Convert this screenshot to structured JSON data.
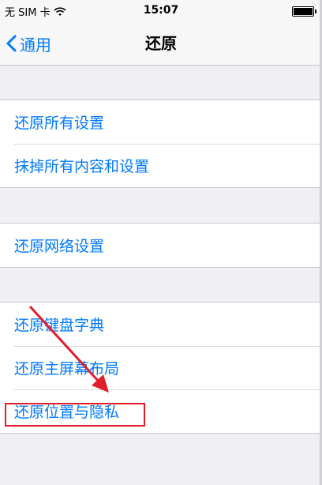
{
  "status_bar": {
    "carrier": "无 SIM 卡",
    "time": "15:07"
  },
  "nav": {
    "back_label": "通用",
    "title": "还原"
  },
  "groups": [
    {
      "items": [
        {
          "label": "还原所有设置"
        },
        {
          "label": "抹掉所有内容和设置"
        }
      ]
    },
    {
      "items": [
        {
          "label": "还原网络设置"
        }
      ]
    },
    {
      "items": [
        {
          "label": "还原键盘字典"
        },
        {
          "label": "还原主屏幕布局"
        },
        {
          "label": "还原位置与隐私"
        }
      ]
    }
  ],
  "annotation": {
    "color": "#e21d2a"
  },
  "colors": {
    "accent": "#007aff",
    "background": "#efeff4"
  },
  "icons": [
    "wifi-icon",
    "battery-icon",
    "chevron-left-icon"
  ]
}
